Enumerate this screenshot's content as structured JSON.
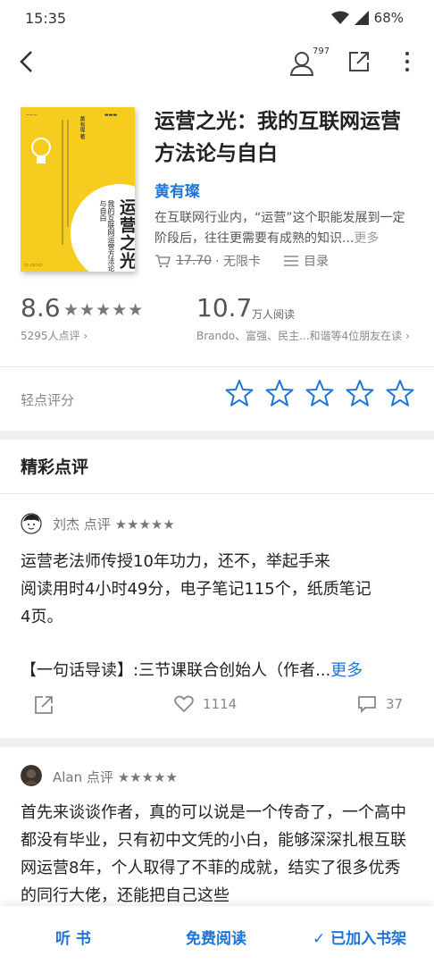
{
  "status": {
    "time": "15:35",
    "battery": "68%"
  },
  "topbar": {
    "reader_count": "797"
  },
  "book": {
    "title": "运营之光：我的互联网运营方法论与自白",
    "author": "黄有璨",
    "intro": "在互联网行业内，“运营”这个职能发展到一定阶段后，往往更需要有成熟的知识...",
    "intro_more": "更多",
    "price": "17.70",
    "price_tail": "· 无限卡",
    "catalog": "目录",
    "cover": {
      "big_title": "运营之光",
      "subtitle": "我的互联网运营方法论与自白",
      "author": "黄有璨 著"
    }
  },
  "stats": {
    "score": "8.6",
    "score_stars": "★★★★★",
    "raters": "5295人点评 ›",
    "reading": "10.7",
    "reading_unit": "万人阅读",
    "friends": "Brando、富强、民主...和谐等4位朋友在读 ›"
  },
  "rating": {
    "label": "轻点评分",
    "max_stars": 5
  },
  "reviews_section": {
    "title": "精彩点评"
  },
  "reviews": [
    {
      "name": "刘杰 点评",
      "stars": "★★★★★",
      "body": "运营老法师传授10年功力，还不，举起手来\n阅读用时4小时49分，电子笔记115个，纸质笔记4页。",
      "teaser": "【一句话导读】:三节课联合创始人（作者...",
      "teaser_more": "更多",
      "likes": "1114",
      "comments": "37"
    },
    {
      "name": "Alan 点评",
      "stars": "★★★★★",
      "body": "首先来谈谈作者，真的可以说是一个传奇了，一个高中都没有毕业，只有初中文凭的小白，能够深深扎根互联网运营8年，个人取得了不菲的成就，结实了很多优秀的同行大佬，还能把自己这些"
    }
  ],
  "bottom": {
    "listen": "听 书",
    "free_read": "免费阅读",
    "added": "✓ 已加入书架"
  },
  "colors": {
    "accent": "#1f74d8",
    "cover": "#f6cd1f"
  }
}
